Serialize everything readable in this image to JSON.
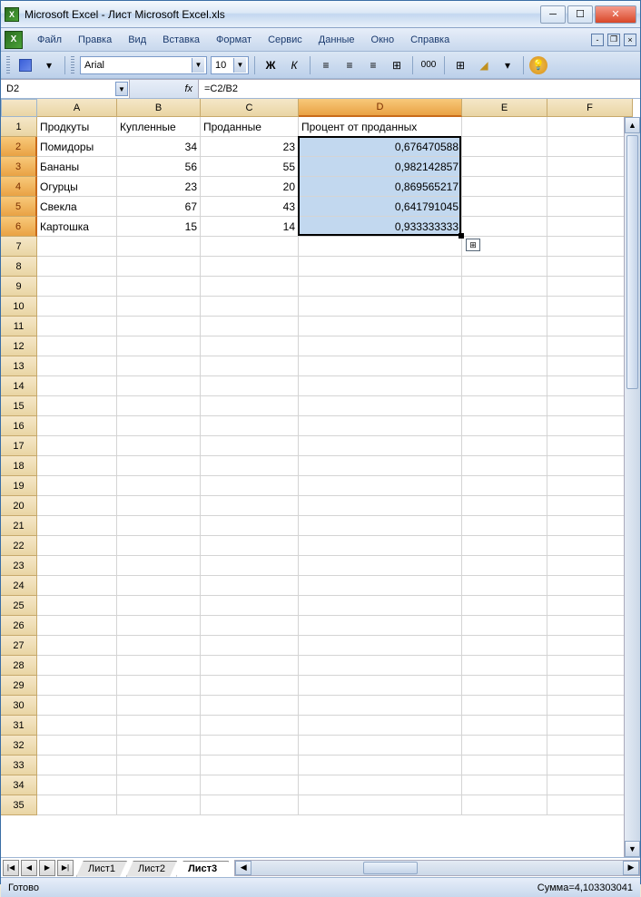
{
  "title": "Microsoft Excel - Лист Microsoft Excel.xls",
  "menu": {
    "file": "Файл",
    "edit": "Правка",
    "view": "Вид",
    "insert": "Вставка",
    "format": "Формат",
    "tools": "Сервис",
    "data": "Данные",
    "window": "Окно",
    "help": "Справка"
  },
  "toolbar": {
    "font_name": "Arial",
    "font_size": "10"
  },
  "namebox": "D2",
  "fx_label": "fx",
  "formula": "=C2/B2",
  "columns": [
    {
      "label": "A",
      "w": 88
    },
    {
      "label": "B",
      "w": 92
    },
    {
      "label": "C",
      "w": 108
    },
    {
      "label": "D",
      "w": 180
    },
    {
      "label": "E",
      "w": 94
    },
    {
      "label": "F",
      "w": 94
    }
  ],
  "row_count": 35,
  "selected_col": "D",
  "selected_rows": [
    2,
    3,
    4,
    5,
    6
  ],
  "headers": {
    "A1": "Продкуты",
    "B1": "Купленные",
    "C1": "Проданные",
    "D1": "Процент от проданных"
  },
  "data_rows": [
    {
      "A": "Помидоры",
      "B": "34",
      "C": "23",
      "D": "0,676470588"
    },
    {
      "A": "Бананы",
      "B": "56",
      "C": "55",
      "D": "0,982142857"
    },
    {
      "A": "Огурцы",
      "B": "23",
      "C": "20",
      "D": "0,869565217"
    },
    {
      "A": "Свекла",
      "B": "67",
      "C": "43",
      "D": "0,641791045"
    },
    {
      "A": "Картошка",
      "B": "15",
      "C": "14",
      "D": "0,933333333"
    }
  ],
  "tabs": [
    "Лист1",
    "Лист2",
    "Лист3"
  ],
  "active_tab": 2,
  "status": {
    "ready": "Готово",
    "sum": "Сумма=4,103303041"
  }
}
